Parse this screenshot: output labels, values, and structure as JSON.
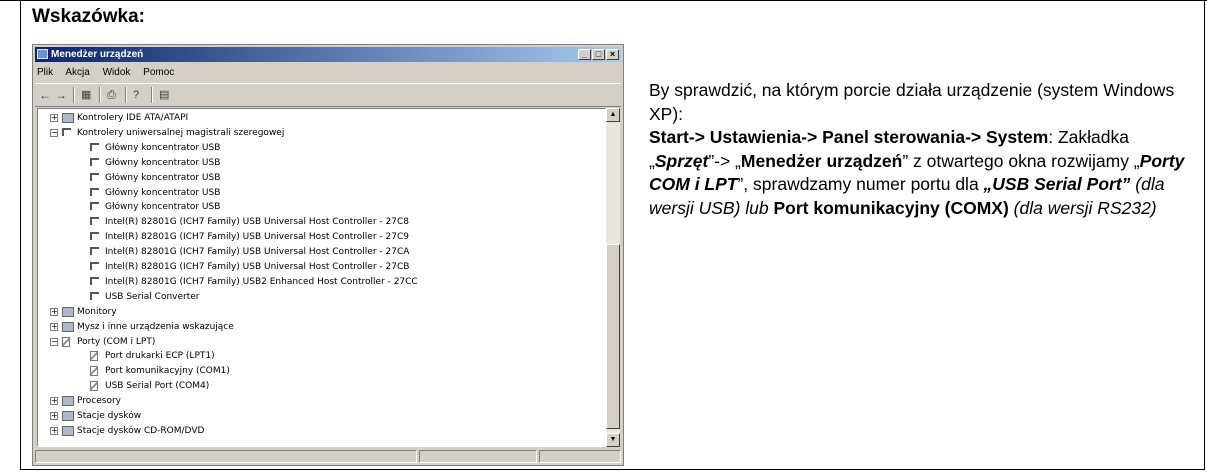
{
  "heading": "Wskazówka:",
  "window": {
    "title": "Menedżer urządzeń",
    "controls": [
      "_",
      "□",
      "×"
    ],
    "menu": [
      "Plik",
      "Akcja",
      "Widok",
      "Pomoc"
    ],
    "toolbar_icons": [
      "back-arrow-icon",
      "forward-arrow-icon",
      "properties-icon",
      "print-icon",
      "help-icon",
      "scan-hardware-icon"
    ],
    "tree": [
      {
        "text": "Kontrolery IDE ATA/ATAPI",
        "level": 1,
        "expander": "+",
        "icon": "ide-icon"
      },
      {
        "text": "Kontrolery uniwersalnej magistrali szeregowej",
        "level": 1,
        "expander": "-",
        "icon": "usb-icon"
      },
      {
        "text": "Główny koncentrator USB",
        "level": 2,
        "icon": "usb-icon"
      },
      {
        "text": "Główny koncentrator USB",
        "level": 2,
        "icon": "usb-icon"
      },
      {
        "text": "Główny koncentrator USB",
        "level": 2,
        "icon": "usb-icon"
      },
      {
        "text": "Główny koncentrator USB",
        "level": 2,
        "icon": "usb-icon"
      },
      {
        "text": "Główny koncentrator USB",
        "level": 2,
        "icon": "usb-icon"
      },
      {
        "text": "Intel(R) 82801G (ICH7 Family) USB Universal Host Controller - 27C8",
        "level": 2,
        "icon": "usb-icon"
      },
      {
        "text": "Intel(R) 82801G (ICH7 Family) USB Universal Host Controller - 27C9",
        "level": 2,
        "icon": "usb-icon"
      },
      {
        "text": "Intel(R) 82801G (ICH7 Family) USB Universal Host Controller - 27CA",
        "level": 2,
        "icon": "usb-icon"
      },
      {
        "text": "Intel(R) 82801G (ICH7 Family) USB Universal Host Controller - 27CB",
        "level": 2,
        "icon": "usb-icon"
      },
      {
        "text": "Intel(R) 82801G (ICH7 Family) USB2 Enhanced Host Controller - 27CC",
        "level": 2,
        "icon": "usb-icon"
      },
      {
        "text": "USB Serial Converter",
        "level": 2,
        "icon": "usb-icon"
      },
      {
        "text": "Monitory",
        "level": 1,
        "expander": "+",
        "icon": "monitor-icon"
      },
      {
        "text": "Mysz i inne urządzenia wskazujące",
        "level": 1,
        "expander": "+",
        "icon": "mouse-icon"
      },
      {
        "text": "Porty (COM i LPT)",
        "level": 1,
        "expander": "-",
        "icon": "port-icon"
      },
      {
        "text": "Port drukarki ECP (LPT1)",
        "level": 2,
        "icon": "port-icon"
      },
      {
        "text": "Port komunikacyjny (COM1)",
        "level": 2,
        "icon": "port-icon"
      },
      {
        "text": "USB Serial Port (COM4)",
        "level": 2,
        "icon": "port-icon"
      },
      {
        "text": "Procesory",
        "level": 1,
        "expander": "+",
        "icon": "cpu-icon"
      },
      {
        "text": "Stacje dysków",
        "level": 1,
        "expander": "+",
        "icon": "disk-icon"
      },
      {
        "text": "Stacje dysków CD-ROM/DVD",
        "level": 1,
        "expander": "+",
        "icon": "cdrom-icon"
      }
    ]
  },
  "hint": {
    "line1": "By sprawdzić, na którym porcie działa urządzenie (system Windows XP):",
    "path_bold": "Start-> Ustawienia-> Panel sterowania-> System",
    "colon": ": Zakładka „",
    "sprzet": "Sprzęt",
    "after_sprzet": "”-> „",
    "menedzer": "Menedżer urządzeń",
    "after_menedzer": "” z otwartego okna rozwijamy „",
    "porty": "Porty COM i LPT",
    "after_porty": "”, sprawdzamy numer portu dla ",
    "usb_serial": "„USB Serial Port”",
    "usb_note": " (dla wersji USB) lub ",
    "port_kom": "Port komunikacyjny (COMX)",
    "rs_note": " (dla wersji RS232)"
  },
  "colors": {
    "highlight_oval": "#e0251a",
    "titlebar": "#0a246a"
  }
}
